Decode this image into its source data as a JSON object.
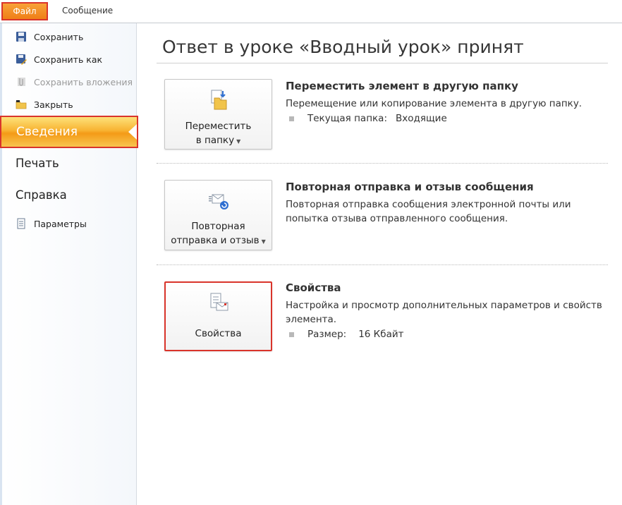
{
  "ribbon": {
    "file_tab": "Файл",
    "message_tab": "Сообщение"
  },
  "backstage": {
    "commands": {
      "save": "Сохранить",
      "save_as": "Сохранить как",
      "save_attachments": "Сохранить вложения",
      "close": "Закрыть"
    },
    "info_tab": "Сведения",
    "print_tab": "Печать",
    "help_tab": "Справка",
    "options": "Параметры"
  },
  "main": {
    "title": "Ответ в уроке «Вводный урок» принят",
    "move": {
      "button_line1": "Переместить",
      "button_line2": "в папку",
      "heading": "Переместить элемент в другую папку",
      "description": "Перемещение или копирование элемента в другую папку.",
      "prop_label": "Текущая папка:",
      "prop_value": "Входящие"
    },
    "resend": {
      "button_line1": "Повторная",
      "button_line2": "отправка и отзыв",
      "heading": "Повторная отправка и отзыв сообщения",
      "description": "Повторная отправка сообщения электронной почты или попытка отзыва отправленного сообщения."
    },
    "properties": {
      "button_label": "Свойства",
      "heading": "Свойства",
      "description": "Настройка и просмотр дополнительных параметров и свойств элемента.",
      "prop_label": "Размер:",
      "prop_value": "16 Кбайт"
    }
  }
}
